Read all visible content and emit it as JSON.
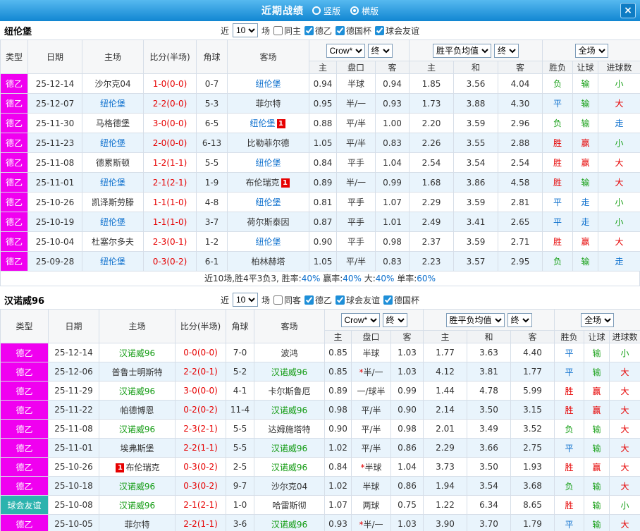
{
  "titlebar": {
    "title": "近期战绩",
    "radios": [
      {
        "label": "竖版",
        "selected": false
      },
      {
        "label": "横版",
        "selected": true
      }
    ],
    "close": "×"
  },
  "labels": {
    "near": "近",
    "games": "场"
  },
  "controls": {
    "odds_company": "Crow*",
    "stage": "终",
    "avg_label": "胜平负均值",
    "scope": "全场"
  },
  "columns": {
    "main": [
      "类型",
      "日期",
      "主场",
      "比分(半场)",
      "角球",
      "客场"
    ],
    "sub": [
      "主",
      "盘口",
      "客",
      "主",
      "和",
      "客",
      "胜负",
      "让球",
      "进球数"
    ]
  },
  "sections": [
    {
      "team": "纽伦堡",
      "near_count": "10",
      "filters": [
        {
          "label": "同主",
          "checked": false
        },
        {
          "label": "德乙",
          "checked": true
        },
        {
          "label": "德国杯",
          "checked": true
        },
        {
          "label": "球会友谊",
          "checked": true
        }
      ],
      "rows": [
        {
          "league": "德乙",
          "lc": "m",
          "date": "25-12-14",
          "home": {
            "n": "沙尔克04"
          },
          "score": "1-0(0-0)",
          "corner": "0-7",
          "away": {
            "n": "纽伦堡",
            "c": "blue"
          },
          "o1": "0.94",
          "hc": "半球",
          "star": false,
          "o2": "0.94",
          "a1": "1.85",
          "a2": "3.56",
          "a3": "4.04",
          "res": [
            "负",
            "g"
          ],
          "let": [
            "输",
            "g"
          ],
          "goal": [
            "小",
            "g"
          ]
        },
        {
          "league": "德乙",
          "lc": "m",
          "date": "25-12-07",
          "home": {
            "n": "纽伦堡",
            "c": "blue"
          },
          "score": "2-2(0-0)",
          "corner": "5-3",
          "away": {
            "n": "菲尔特"
          },
          "o1": "0.95",
          "hc": "半/一",
          "star": false,
          "o2": "0.93",
          "a1": "1.73",
          "a2": "3.88",
          "a3": "4.30",
          "res": [
            "平",
            "b"
          ],
          "let": [
            "输",
            "g"
          ],
          "goal": [
            "大",
            "r"
          ]
        },
        {
          "league": "德乙",
          "lc": "m",
          "date": "25-11-30",
          "home": {
            "n": "马格德堡"
          },
          "score": "3-0(0-0)",
          "corner": "6-5",
          "away": {
            "n": "纽伦堡",
            "c": "blue",
            "badge": "1",
            "bp": "after"
          },
          "o1": "0.88",
          "hc": "平/半",
          "star": false,
          "o2": "1.00",
          "a1": "2.20",
          "a2": "3.59",
          "a3": "2.96",
          "res": [
            "负",
            "g"
          ],
          "let": [
            "输",
            "g"
          ],
          "goal": [
            "走",
            "b"
          ]
        },
        {
          "league": "德乙",
          "lc": "m",
          "date": "25-11-23",
          "home": {
            "n": "纽伦堡",
            "c": "blue"
          },
          "score": "2-0(0-0)",
          "corner": "6-13",
          "away": {
            "n": "比勒菲尔德"
          },
          "o1": "1.05",
          "hc": "平/半",
          "star": false,
          "o2": "0.83",
          "a1": "2.26",
          "a2": "3.55",
          "a3": "2.88",
          "res": [
            "胜",
            "r"
          ],
          "let": [
            "赢",
            "r"
          ],
          "goal": [
            "小",
            "g"
          ]
        },
        {
          "league": "德乙",
          "lc": "m",
          "date": "25-11-08",
          "home": {
            "n": "德累斯顿"
          },
          "score": "1-2(1-1)",
          "corner": "5-5",
          "away": {
            "n": "纽伦堡",
            "c": "blue"
          },
          "o1": "0.84",
          "hc": "平手",
          "star": false,
          "o2": "1.04",
          "a1": "2.54",
          "a2": "3.54",
          "a3": "2.54",
          "res": [
            "胜",
            "r"
          ],
          "let": [
            "赢",
            "r"
          ],
          "goal": [
            "大",
            "r"
          ]
        },
        {
          "league": "德乙",
          "lc": "m",
          "date": "25-11-01",
          "home": {
            "n": "纽伦堡",
            "c": "blue"
          },
          "score": "2-1(2-1)",
          "corner": "1-9",
          "away": {
            "n": "布伦瑞克",
            "badge": "1",
            "bp": "after"
          },
          "o1": "0.89",
          "hc": "半/一",
          "star": false,
          "o2": "0.99",
          "a1": "1.68",
          "a2": "3.86",
          "a3": "4.58",
          "res": [
            "胜",
            "r"
          ],
          "let": [
            "输",
            "g"
          ],
          "goal": [
            "大",
            "r"
          ]
        },
        {
          "league": "德乙",
          "lc": "m",
          "date": "25-10-26",
          "home": {
            "n": "凯泽斯劳滕"
          },
          "score": "1-1(1-0)",
          "corner": "4-8",
          "away": {
            "n": "纽伦堡",
            "c": "blue"
          },
          "o1": "0.81",
          "hc": "平手",
          "star": false,
          "o2": "1.07",
          "a1": "2.29",
          "a2": "3.59",
          "a3": "2.81",
          "res": [
            "平",
            "b"
          ],
          "let": [
            "走",
            "b"
          ],
          "goal": [
            "小",
            "g"
          ]
        },
        {
          "league": "德乙",
          "lc": "m",
          "date": "25-10-19",
          "home": {
            "n": "纽伦堡",
            "c": "blue"
          },
          "score": "1-1(1-0)",
          "corner": "3-7",
          "away": {
            "n": "荷尔斯泰因"
          },
          "o1": "0.87",
          "hc": "平手",
          "star": false,
          "o2": "1.01",
          "a1": "2.49",
          "a2": "3.41",
          "a3": "2.65",
          "res": [
            "平",
            "b"
          ],
          "let": [
            "走",
            "b"
          ],
          "goal": [
            "小",
            "g"
          ]
        },
        {
          "league": "德乙",
          "lc": "m",
          "date": "25-10-04",
          "home": {
            "n": "杜塞尔多夫"
          },
          "score": "2-3(0-1)",
          "corner": "1-2",
          "away": {
            "n": "纽伦堡",
            "c": "blue"
          },
          "o1": "0.90",
          "hc": "平手",
          "star": false,
          "o2": "0.98",
          "a1": "2.37",
          "a2": "3.59",
          "a3": "2.71",
          "res": [
            "胜",
            "r"
          ],
          "let": [
            "赢",
            "r"
          ],
          "goal": [
            "大",
            "r"
          ]
        },
        {
          "league": "德乙",
          "lc": "m",
          "date": "25-09-28",
          "home": {
            "n": "纽伦堡",
            "c": "blue"
          },
          "score": "0-3(0-2)",
          "corner": "6-1",
          "away": {
            "n": "柏林赫塔"
          },
          "o1": "1.05",
          "hc": "平/半",
          "star": false,
          "o2": "0.83",
          "a1": "2.23",
          "a2": "3.57",
          "a3": "2.95",
          "res": [
            "负",
            "g"
          ],
          "let": [
            "输",
            "g"
          ],
          "goal": [
            "走",
            "b"
          ]
        }
      ],
      "summary": [
        {
          "t": "近10场,胜4平3负3, 胜率:",
          "c": ""
        },
        {
          "t": "40%",
          "c": "b"
        },
        {
          "t": " 赢率:",
          "c": ""
        },
        {
          "t": "40%",
          "c": "b"
        },
        {
          "t": " 大:",
          "c": ""
        },
        {
          "t": "40%",
          "c": "b"
        },
        {
          "t": " 单率:",
          "c": ""
        },
        {
          "t": "60%",
          "c": "b"
        }
      ]
    },
    {
      "team": "汉诺威96",
      "near_count": "10",
      "filters": [
        {
          "label": "同客",
          "checked": false
        },
        {
          "label": "德乙",
          "checked": true
        },
        {
          "label": "球会友谊",
          "checked": true
        },
        {
          "label": "德国杯",
          "checked": true
        }
      ],
      "rows": [
        {
          "league": "德乙",
          "lc": "m",
          "date": "25-12-14",
          "home": {
            "n": "汉诺威96",
            "c": "green"
          },
          "score": "0-0(0-0)",
          "corner": "7-0",
          "away": {
            "n": "波鸿"
          },
          "o1": "0.85",
          "hc": "半球",
          "star": false,
          "o2": "1.03",
          "a1": "1.77",
          "a2": "3.63",
          "a3": "4.40",
          "res": [
            "平",
            "b"
          ],
          "let": [
            "输",
            "g"
          ],
          "goal": [
            "小",
            "g"
          ]
        },
        {
          "league": "德乙",
          "lc": "m",
          "date": "25-12-06",
          "home": {
            "n": "普鲁士明斯特"
          },
          "score": "2-2(0-1)",
          "corner": "5-2",
          "away": {
            "n": "汉诺威96",
            "c": "green"
          },
          "o1": "0.85",
          "hc": "半/一",
          "star": true,
          "o2": "1.03",
          "a1": "4.12",
          "a2": "3.81",
          "a3": "1.77",
          "res": [
            "平",
            "b"
          ],
          "let": [
            "输",
            "g"
          ],
          "goal": [
            "大",
            "r"
          ]
        },
        {
          "league": "德乙",
          "lc": "m",
          "date": "25-11-29",
          "home": {
            "n": "汉诺威96",
            "c": "green"
          },
          "score": "3-0(0-0)",
          "corner": "4-1",
          "away": {
            "n": "卡尔斯鲁厄"
          },
          "o1": "0.89",
          "hc": "一/球半",
          "star": false,
          "o2": "0.99",
          "a1": "1.44",
          "a2": "4.78",
          "a3": "5.99",
          "res": [
            "胜",
            "r"
          ],
          "let": [
            "赢",
            "r"
          ],
          "goal": [
            "大",
            "r"
          ]
        },
        {
          "league": "德乙",
          "lc": "m",
          "date": "25-11-22",
          "home": {
            "n": "帕德博恩"
          },
          "score": "0-2(0-2)",
          "corner": "11-4",
          "away": {
            "n": "汉诺威96",
            "c": "green"
          },
          "o1": "0.98",
          "hc": "平/半",
          "star": false,
          "o2": "0.90",
          "a1": "2.14",
          "a2": "3.50",
          "a3": "3.15",
          "res": [
            "胜",
            "r"
          ],
          "let": [
            "赢",
            "r"
          ],
          "goal": [
            "大",
            "r"
          ]
        },
        {
          "league": "德乙",
          "lc": "m",
          "date": "25-11-08",
          "home": {
            "n": "汉诺威96",
            "c": "green"
          },
          "score": "2-3(2-1)",
          "corner": "5-5",
          "away": {
            "n": "达姆施塔特"
          },
          "o1": "0.90",
          "hc": "平/半",
          "star": false,
          "o2": "0.98",
          "a1": "2.01",
          "a2": "3.49",
          "a3": "3.52",
          "res": [
            "负",
            "g"
          ],
          "let": [
            "输",
            "g"
          ],
          "goal": [
            "大",
            "r"
          ]
        },
        {
          "league": "德乙",
          "lc": "m",
          "date": "25-11-01",
          "home": {
            "n": "埃弗斯堡"
          },
          "score": "2-2(1-1)",
          "corner": "5-5",
          "away": {
            "n": "汉诺威96",
            "c": "green"
          },
          "o1": "1.02",
          "hc": "平/半",
          "star": false,
          "o2": "0.86",
          "a1": "2.29",
          "a2": "3.66",
          "a3": "2.75",
          "res": [
            "平",
            "b"
          ],
          "let": [
            "输",
            "g"
          ],
          "goal": [
            "大",
            "r"
          ]
        },
        {
          "league": "德乙",
          "lc": "m",
          "date": "25-10-26",
          "home": {
            "n": "布伦瑞克",
            "badge": "1",
            "bp": "before"
          },
          "score": "0-3(0-2)",
          "corner": "2-5",
          "away": {
            "n": "汉诺威96",
            "c": "green"
          },
          "o1": "0.84",
          "hc": "半球",
          "star": true,
          "o2": "1.04",
          "a1": "3.73",
          "a2": "3.50",
          "a3": "1.93",
          "res": [
            "胜",
            "r"
          ],
          "let": [
            "赢",
            "r"
          ],
          "goal": [
            "大",
            "r"
          ]
        },
        {
          "league": "德乙",
          "lc": "m",
          "date": "25-10-18",
          "home": {
            "n": "汉诺威96",
            "c": "green"
          },
          "score": "0-3(0-2)",
          "corner": "9-7",
          "away": {
            "n": "沙尔克04"
          },
          "o1": "1.02",
          "hc": "半球",
          "star": false,
          "o2": "0.86",
          "a1": "1.94",
          "a2": "3.54",
          "a3": "3.68",
          "res": [
            "负",
            "g"
          ],
          "let": [
            "输",
            "g"
          ],
          "goal": [
            "大",
            "r"
          ]
        },
        {
          "league": "球会友谊",
          "lc": "t",
          "date": "25-10-08",
          "home": {
            "n": "汉诺威96",
            "c": "green"
          },
          "score": "2-1(2-1)",
          "corner": "1-0",
          "away": {
            "n": "哈雷斯彻"
          },
          "o1": "1.07",
          "hc": "两球",
          "star": false,
          "o2": "0.75",
          "a1": "1.22",
          "a2": "6.34",
          "a3": "8.65",
          "res": [
            "胜",
            "r"
          ],
          "let": [
            "输",
            "g"
          ],
          "goal": [
            "小",
            "g"
          ]
        },
        {
          "league": "德乙",
          "lc": "m",
          "date": "25-10-05",
          "home": {
            "n": "菲尔特"
          },
          "score": "2-2(1-1)",
          "corner": "3-6",
          "away": {
            "n": "汉诺威96",
            "c": "green"
          },
          "o1": "0.93",
          "hc": "半/一",
          "star": true,
          "o2": "1.03",
          "a1": "3.90",
          "a2": "3.70",
          "a3": "1.79",
          "res": [
            "平",
            "b"
          ],
          "let": [
            "输",
            "g"
          ],
          "goal": [
            "大",
            "r"
          ]
        }
      ]
    }
  ]
}
